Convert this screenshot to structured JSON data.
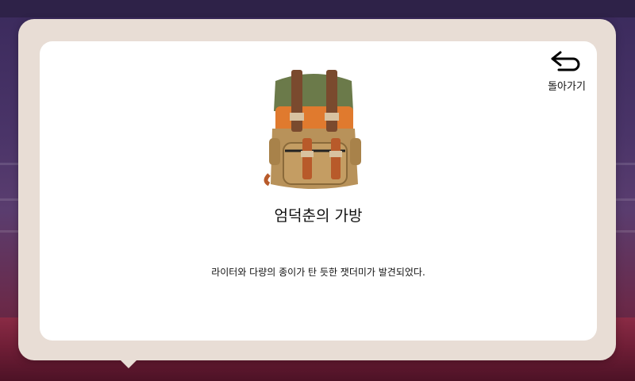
{
  "dialog": {
    "back_label": "돌아가기",
    "back_icon": "return-arrow-icon",
    "item": {
      "name": "엄덕춘의 가방",
      "description": "라이터와 다량의 종이가 탄 듯한 잿더미가 발견되었다.",
      "image_icon": "backpack-icon"
    }
  },
  "colors": {
    "frame": "#e8ddd5",
    "card": "#ffffff",
    "backpack_body": "#b8925a",
    "backpack_top_green": "#6b7a4a",
    "backpack_orange": "#e07a2e",
    "backpack_straps": "#b85a2a"
  }
}
